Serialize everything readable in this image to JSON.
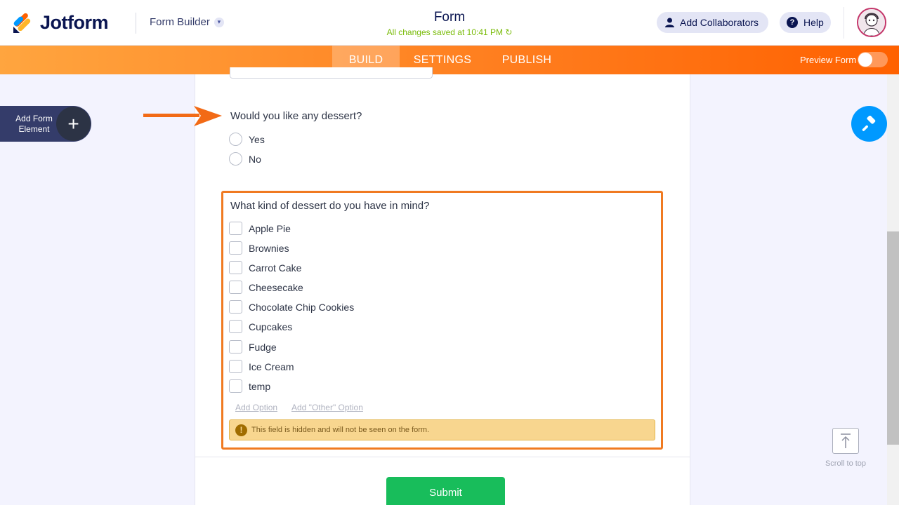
{
  "header": {
    "brand": "Jotform",
    "builder_label": "Form Builder",
    "form_title": "Form",
    "save_status": "All changes saved at 10:41 PM",
    "add_collaborators": "Add Collaborators",
    "help": "Help"
  },
  "nav": {
    "tabs": [
      "BUILD",
      "SETTINGS",
      "PUBLISH"
    ],
    "active_tab": "BUILD",
    "preview_label": "Preview Form",
    "preview_on": false
  },
  "sidebar": {
    "add_element_label": "Add Form Element"
  },
  "form": {
    "q1": {
      "label": "Would you like any dessert?",
      "options": [
        "Yes",
        "No"
      ]
    },
    "q2": {
      "label": "What kind of dessert do you have in mind?",
      "options": [
        "Apple Pie",
        "Brownies",
        "Carrot Cake",
        "Cheesecake",
        "Chocolate Chip Cookies",
        "Cupcakes",
        "Fudge",
        "Ice Cream",
        "temp"
      ],
      "add_option": "Add Option",
      "add_other_option": "Add \"Other\" Option",
      "hidden_notice": "This field is hidden and will not be seen on the form."
    },
    "submit_label": "Submit"
  },
  "scroll_to_top_label": "Scroll to top",
  "colors": {
    "accent_orange": "#ff6100",
    "brand_navy": "#0a1551",
    "saved_green": "#78bb07",
    "submit_green": "#18bd5b",
    "designer_blue": "#0099ff"
  }
}
